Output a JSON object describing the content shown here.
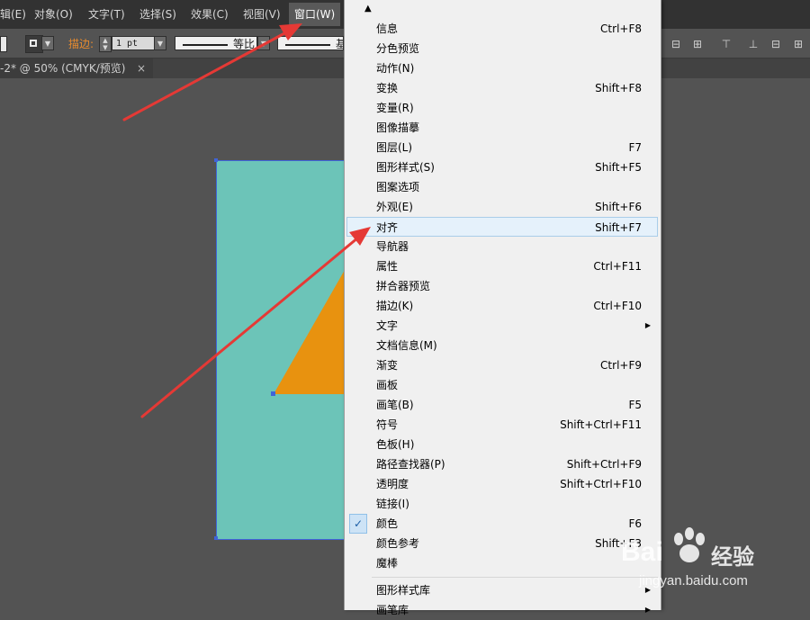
{
  "menubar": {
    "items": [
      "辑(E)",
      "对象(O)",
      "文字(T)",
      "选择(S)",
      "效果(C)",
      "视图(V)",
      "窗口(W)"
    ]
  },
  "controlbar": {
    "stroke_label": "描边:",
    "stroke_value": "1 pt",
    "profile_uniform": "等比",
    "profile_basic": "基本"
  },
  "doctab": {
    "title": "-2* @ 50% (CMYK/预览)",
    "close": "×"
  },
  "dropdown": {
    "scroll_up": "▲",
    "items": [
      {
        "label": "信息",
        "shortcut": "Ctrl+F8"
      },
      {
        "label": "分色预览",
        "shortcut": ""
      },
      {
        "label": "动作(N)",
        "shortcut": ""
      },
      {
        "label": "变换",
        "shortcut": "Shift+F8"
      },
      {
        "label": "变量(R)",
        "shortcut": ""
      },
      {
        "label": "图像描摹",
        "shortcut": ""
      },
      {
        "label": "图层(L)",
        "shortcut": "F7"
      },
      {
        "label": "图形样式(S)",
        "shortcut": "Shift+F5"
      },
      {
        "label": "图案选项",
        "shortcut": ""
      },
      {
        "label": "外观(E)",
        "shortcut": "Shift+F6"
      },
      {
        "label": "对齐",
        "shortcut": "Shift+F7"
      },
      {
        "label": "导航器",
        "shortcut": ""
      },
      {
        "label": "属性",
        "shortcut": "Ctrl+F11"
      },
      {
        "label": "拼合器预览",
        "shortcut": ""
      },
      {
        "label": "描边(K)",
        "shortcut": "Ctrl+F10"
      },
      {
        "label": "文字",
        "shortcut": ""
      },
      {
        "label": "文档信息(M)",
        "shortcut": ""
      },
      {
        "label": "渐变",
        "shortcut": "Ctrl+F9"
      },
      {
        "label": "画板",
        "shortcut": ""
      },
      {
        "label": "画笔(B)",
        "shortcut": "F5"
      },
      {
        "label": "符号",
        "shortcut": "Shift+Ctrl+F11"
      },
      {
        "label": "色板(H)",
        "shortcut": ""
      },
      {
        "label": "路径查找器(P)",
        "shortcut": "Shift+Ctrl+F9"
      },
      {
        "label": "透明度",
        "shortcut": "Shift+Ctrl+F10"
      },
      {
        "label": "链接(I)",
        "shortcut": ""
      },
      {
        "label": "颜色",
        "shortcut": "F6"
      },
      {
        "label": "颜色参考",
        "shortcut": "Shift+F3"
      },
      {
        "label": "魔棒",
        "shortcut": ""
      },
      {
        "label": "图形样式库",
        "shortcut": ""
      },
      {
        "label": "画笔库",
        "shortcut": ""
      }
    ],
    "submenu_arrow": "▶",
    "check_mark": "✓"
  },
  "watermark": {
    "brand": "Bai",
    "brand_cn": "经验",
    "url": "jingyan.baidu.com"
  },
  "colors": {
    "artboard_fill": "#6cc4b8",
    "triangle_fill": "#e8920f",
    "arrow_red": "#e53935",
    "accent_orange": "#e88b2e"
  }
}
